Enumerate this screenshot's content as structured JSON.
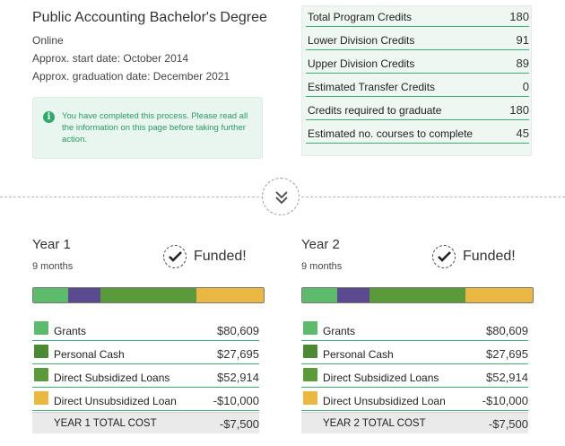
{
  "program": {
    "title": "Public Accounting Bachelor's Degree",
    "format": "Online",
    "start": "Approx. start date: October 2014",
    "graduation": "Approx. graduation date: December 2021"
  },
  "notice": {
    "icon": "info-icon",
    "text": "You have completed this process. Please read all the information on this page before taking further action."
  },
  "credits": [
    {
      "label": "Total Program Credits",
      "value": "180"
    },
    {
      "label": "Lower Division Credits",
      "value": "91"
    },
    {
      "label": "Upper Division Credits",
      "value": "89"
    },
    {
      "label": "Estimated Transfer Credits",
      "value": "0"
    },
    {
      "label": "Credits required to graduate",
      "value": "180"
    },
    {
      "label": "Estimated no. courses to complete",
      "value": "45"
    }
  ],
  "expand_icon": "double-chevron-down-icon",
  "colors": {
    "grants": "#5cbc6c",
    "personal_cash": "#5c4a90",
    "subsidized": "#5a9a3a",
    "unsubsidized": "#eab840",
    "accent": "#3daf73"
  },
  "years": [
    {
      "title": "Year 1",
      "duration": "9 months",
      "status": "Funded!",
      "items": [
        {
          "label": "Grants",
          "value": "$80,609",
          "swatch": "#5cbc6c"
        },
        {
          "label": "Personal Cash",
          "value": "$27,695",
          "swatch": "#4a8a34"
        },
        {
          "label": "Direct Subsidized Loans",
          "value": "$52,914",
          "swatch": "#5a9a3a"
        },
        {
          "label": "Direct Unsubsidized Loan",
          "value": "-$10,000",
          "swatch": "#eab840"
        }
      ],
      "total_label": "YEAR 1 TOTAL COST",
      "total_value": "-$7,500"
    },
    {
      "title": "Year 2",
      "duration": "9 months",
      "status": "Funded!",
      "items": [
        {
          "label": "Grants",
          "value": "$80,609",
          "swatch": "#5cbc6c"
        },
        {
          "label": "Personal Cash",
          "value": "$27,695",
          "swatch": "#4a8a34"
        },
        {
          "label": "Direct Subsidized Loans",
          "value": "$52,914",
          "swatch": "#5a9a3a"
        },
        {
          "label": "Direct Unsubsidized Loan",
          "value": "-$10,000",
          "swatch": "#eab840"
        }
      ],
      "total_label": "YEAR 2 TOTAL COST",
      "total_value": "-$7,500"
    }
  ],
  "funding_bar": [
    {
      "segment": "grants",
      "share": 0.15,
      "color": "#5cbc6c"
    },
    {
      "segment": "personal_cash",
      "share": 0.14,
      "color": "#5c4a90"
    },
    {
      "segment": "subsidized_loans",
      "share": 0.42,
      "color": "#5a9a3a"
    },
    {
      "segment": "unsubsidized_loan",
      "share": 0.29,
      "color": "#eab840"
    }
  ]
}
